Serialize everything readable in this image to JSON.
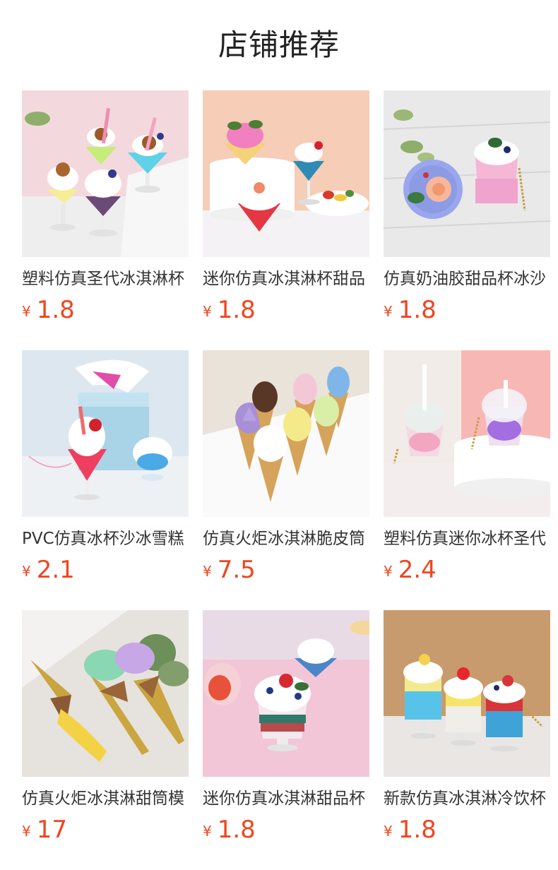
{
  "header": {
    "title": "店铺推荐"
  },
  "products": [
    {
      "name": "塑料仿真圣代冰淇淋杯",
      "currency": "¥",
      "price": "1.8"
    },
    {
      "name": "迷你仿真冰淇淋杯甜品",
      "currency": "¥",
      "price": "1.8"
    },
    {
      "name": "仿真奶油胶甜品杯冰沙",
      "currency": "¥",
      "price": "1.8"
    },
    {
      "name": "PVC仿真冰杯沙冰雪糕",
      "currency": "¥",
      "price": "2.1"
    },
    {
      "name": "仿真火炬冰淇淋脆皮筒",
      "currency": "¥",
      "price": "7.5"
    },
    {
      "name": "塑料仿真迷你冰杯圣代",
      "currency": "¥",
      "price": "2.4"
    },
    {
      "name": "仿真火炬冰淇淋甜筒模",
      "currency": "¥",
      "price": "17"
    },
    {
      "name": "迷你仿真冰淇淋甜品杯",
      "currency": "¥",
      "price": "1.8"
    },
    {
      "name": "新款仿真冰淇淋冷饮杯",
      "currency": "¥",
      "price": "1.8"
    }
  ]
}
